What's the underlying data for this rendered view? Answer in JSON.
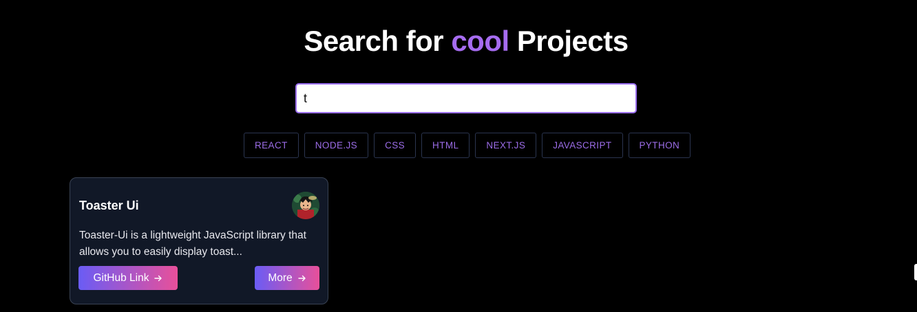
{
  "header": {
    "title_before": "Search for ",
    "title_accent": "cool",
    "title_after": " Projects",
    "accent_color": "#a66cf0"
  },
  "search": {
    "value": "t",
    "placeholder": ""
  },
  "tags": [
    "REACT",
    "NODE.JS",
    "CSS",
    "HTML",
    "NEXT.JS",
    "JAVASCRIPT",
    "PYTHON"
  ],
  "projects": [
    {
      "title": "Toaster Ui",
      "description": "Toaster-Ui is a lightweight JavaScript library that allows you to easily display toast...",
      "github_label": "GitHub Link",
      "more_label": "More",
      "avatar_icon": "avatar-icon",
      "button_gradient": [
        "#6a5cf5",
        "#e8509a"
      ]
    }
  ],
  "theme": {
    "background": "#000000",
    "card_background": "#111827",
    "tag_text": "#9c6de8"
  }
}
